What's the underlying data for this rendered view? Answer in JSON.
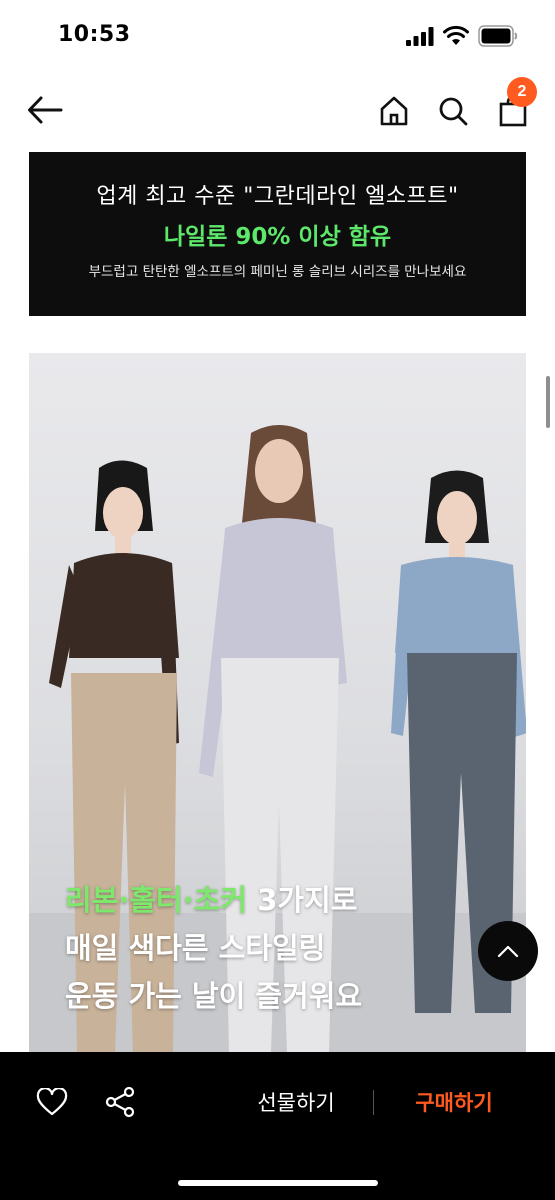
{
  "status_bar": {
    "time": "10:53"
  },
  "nav": {
    "cart_count": "2",
    "icons": [
      "back-arrow-icon",
      "home-icon",
      "search-icon",
      "cart-icon"
    ]
  },
  "promo": {
    "line1": "업계 최고 수준 \"그란데라인 엘소프트\"",
    "line2": "나일론 90% 이상 함유",
    "line3": "부드럽고 탄탄한 엘소프트의 페미닌 롱 슬리브 시리즈를 만나보세요",
    "highlight_color": "#5de86b"
  },
  "product_image": {
    "caption_highlight": "리본·홀터·초커",
    "caption_line1_rest": " 3가지로",
    "caption_line2": "매일 색다른 스타일링",
    "caption_line3": "운동 가는 날이 즐거워요"
  },
  "bottom_bar": {
    "gift_label": "선물하기",
    "buy_label": "구매하기",
    "accent_color": "#ff5a1f",
    "icons": [
      "heart-icon",
      "share-icon"
    ]
  }
}
